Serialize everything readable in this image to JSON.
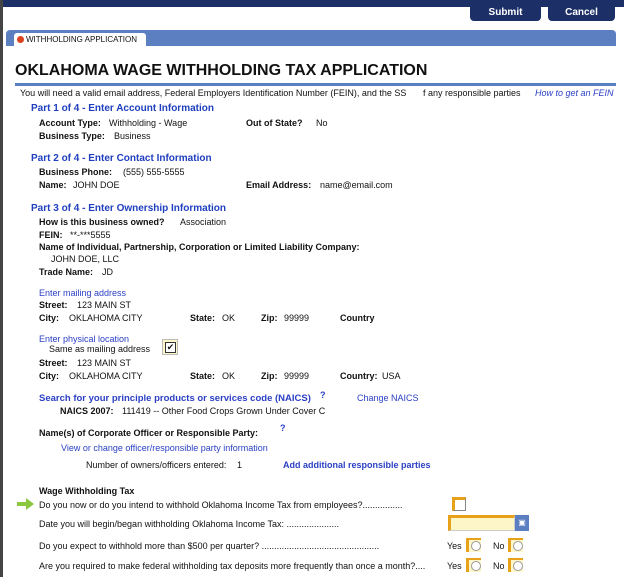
{
  "toolbar": {
    "submit": "Submit",
    "cancel": "Cancel"
  },
  "tab": {
    "label": "WITHHOLDING APPLICATION"
  },
  "title": "OKLAHOMA WAGE WITHHOLDING TAX APPLICATION",
  "intro": {
    "text": "You will need a valid email address, Federal Employers Identification Number (FEIN), and the SS",
    "text2": "f any responsible parties",
    "fein_link": "How to get an FEIN"
  },
  "part1": {
    "header": "Part 1 of 4 - Enter Account Information",
    "account_type_label": "Account Type:",
    "account_type": "Withholding - Wage",
    "out_of_state_label": "Out of State?",
    "out_of_state": "No",
    "business_type_label": "Business Type:",
    "business_type": "Business"
  },
  "part2": {
    "header": "Part 2 of 4 - Enter Contact Information",
    "phone_label": "Business Phone:",
    "phone": "(555) 555-5555",
    "name_label": "Name:",
    "name": "JOHN DOE",
    "email_label": "Email Address:",
    "email": "name@email.com"
  },
  "part3": {
    "header": "Part 3 of 4 - Enter Ownership Information",
    "owned_label": "How is this business owned?",
    "owned": "Association",
    "fein_label": "FEIN:",
    "fein": "**-***5555",
    "entity_label": "Name of Individual, Partnership, Corporation or Limited Liability Company:",
    "entity": "JOHN DOE, LLC",
    "trade_label": "Trade Name:",
    "trade": "JD",
    "mailing": {
      "link": "Enter mailing address",
      "street_label": "Street:",
      "street": "123 MAIN ST",
      "city_label": "City:",
      "city": "OKLAHOMA CITY",
      "state_label": "State:",
      "state": "OK",
      "zip_label": "Zip:",
      "zip": "99999",
      "country_label": "Country",
      "country": ""
    },
    "physical": {
      "link": "Enter physical location",
      "same_label": "Same as mailing address",
      "same_checked": true,
      "street_label": "Street:",
      "street": "123 MAIN ST",
      "city_label": "City:",
      "city": "OKLAHOMA CITY",
      "state_label": "State:",
      "state": "OK",
      "zip_label": "Zip:",
      "zip": "99999",
      "country_label": "Country:",
      "country": "USA"
    },
    "naics": {
      "search_link": "Search for your principle products or services code (NAICS)",
      "help": "?",
      "change_link": "Change NAICS",
      "label": "NAICS 2007:",
      "value": "111419 -- Other Food Crops Grown Under Cover C"
    },
    "officer": {
      "label": "Name(s) of Corporate Officer or Responsible Party:",
      "help": "?",
      "view_link": "View or change officer/responsible party information",
      "count_label": "Number of owners/officers entered:",
      "count": "1",
      "add_link": "Add additional responsible parties"
    }
  },
  "wage": {
    "header": "Wage Withholding Tax",
    "q1": "Do you now or do you intend to withhold Oklahoma Income Tax from employees?................",
    "q2": "Date you will begin/began withholding Oklahoma Income Tax: .....................",
    "q3": "Do you expect to withhold more than $500 per quarter? ...............................................",
    "q4": "Are you required to make federal withholding tax deposits more frequently than once a month?....",
    "yes": "Yes",
    "no": "No",
    "date_value": ""
  },
  "colors": {
    "navy": "#1c2f66",
    "tab_blue": "#5b7fc0",
    "link": "#1f3fbf",
    "required": "#e8a21a",
    "input_bg": "#fdf6c8"
  }
}
